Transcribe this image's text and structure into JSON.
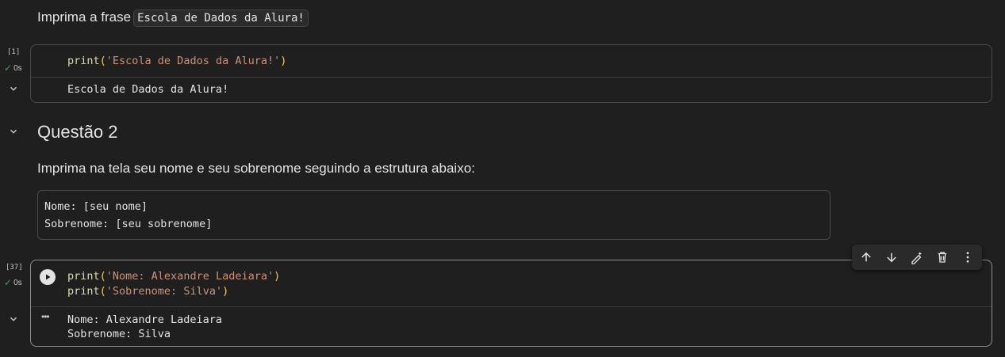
{
  "cell1_markdown": {
    "prefix": "Imprima a frase",
    "inline_code": "Escola de Dados da Alura!"
  },
  "cell1_code": {
    "exec_count": "[1]",
    "exec_time": "0s",
    "code_fn": "print",
    "code_open": "(",
    "code_str": "'Escola de Dados da Alura!'",
    "code_close": ")",
    "output": "Escola de Dados da Alura!"
  },
  "section2": {
    "heading": "Questão 2",
    "instruction": "Imprima na tela seu nome e seu sobrenome seguindo a estrutura abaixo:",
    "code_line1": "Nome: [seu nome]",
    "code_line2": "Sobrenome: [seu sobrenome]"
  },
  "cell2_code": {
    "exec_count": "[37]",
    "exec_time": "0s",
    "line1_fn": "print",
    "line1_open": "(",
    "line1_str": "'Nome: Alexandre Ladeiara'",
    "line1_close": ")",
    "line2_fn": "print",
    "line2_open": "(",
    "line2_str": "'Sobrenome: Silva'",
    "line2_close": ")",
    "output_line1": "Nome: Alexandre Ladeiara",
    "output_line2": "Sobrenome: Silva",
    "ellipsis": "•••"
  },
  "toolbar_icons": [
    "arrow-up-icon",
    "arrow-down-icon",
    "edit-magic-icon",
    "trash-icon",
    "more-vert-icon"
  ],
  "colors": {
    "background": "#1f1f1f",
    "success": "#34a853",
    "string": "#ce9178",
    "keyword": "#dcdcaa",
    "paren": "#ffd700"
  }
}
